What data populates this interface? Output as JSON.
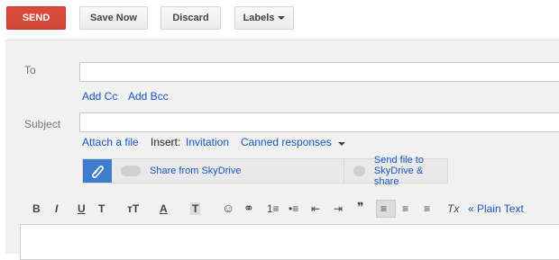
{
  "toolbar": {
    "send_label": "SEND",
    "save_label": "Save Now",
    "discard_label": "Discard",
    "labels_label": "Labels"
  },
  "compose": {
    "to_label": "To",
    "to_value": "",
    "add_cc": "Add Cc",
    "add_bcc": "Add Bcc",
    "subject_label": "Subject",
    "subject_value": "",
    "attach_file": "Attach a file",
    "insert_label": "Insert:",
    "invitation": "Invitation",
    "canned_responses": "Canned responses"
  },
  "skydrive": {
    "share_from": "Share from SkyDrive",
    "send_file": "Send file to SkyDrive & share"
  },
  "format_bar": {
    "bold": "B",
    "italic": "I",
    "underline": "U",
    "font": "T",
    "size": "ᴛT",
    "text_color": "A",
    "highlight": "T",
    "emoji": "☺",
    "link": "⚭",
    "numbered": "1≡",
    "bulleted": "•≡",
    "indent_less": "⇤",
    "indent_more": "⇥",
    "quote": "❞",
    "align_left": "≡",
    "align_center": "≡",
    "align_right": "≡",
    "remove_format": "Tx",
    "plain_text": "« Plain Text"
  },
  "colors": {
    "send": "#d14836",
    "link": "#1a55cc",
    "panel": "#f1f1f1",
    "attach_icon_bg": "#3f7ccc"
  }
}
